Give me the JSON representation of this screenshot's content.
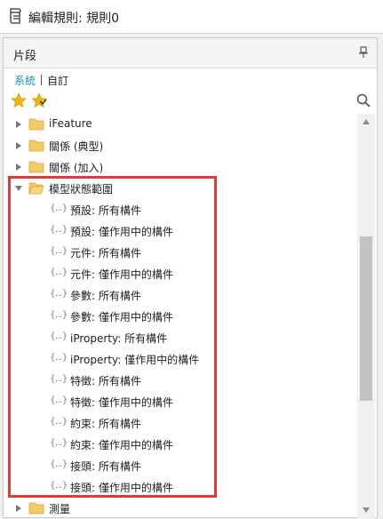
{
  "title": "編輯規則: 規則0",
  "panel": {
    "title": "片段",
    "tabs": {
      "system": "系統",
      "custom": "自訂"
    }
  },
  "tree": {
    "folders_top": [
      {
        "label": "iFeature",
        "expanded": false
      },
      {
        "label": "關係 (典型)",
        "expanded": false
      },
      {
        "label": "關係 (加入)",
        "expanded": false
      }
    ],
    "open_folder": {
      "label": "模型狀態範圍",
      "expanded": true,
      "snippet_icon": "{...}",
      "items": [
        "預設: 所有構件",
        "預設: 僅作用中的構件",
        "元件: 所有構件",
        "元件: 僅作用中的構件",
        "參數: 所有構件",
        "參數: 僅作用中的構件",
        "iProperty: 所有構件",
        "iProperty: 僅作用中的構件",
        "特徵: 所有構件",
        "特徵: 僅作用中的構件",
        "約束: 所有構件",
        "約束: 僅作用中的構件",
        "接頭: 所有構件",
        "接頭: 僅作用中的構件"
      ]
    },
    "folders_bottom": [
      {
        "label": "測量",
        "expanded": false
      }
    ]
  },
  "colors": {
    "accent_link": "#1a8fb8",
    "highlight_border": "#e53935",
    "folder": "#f5c964",
    "star": "#e8a800"
  },
  "icons": {
    "title": "rule-document-icon",
    "pin": "pin-icon",
    "favorite": "star-icon",
    "add_favorite": "star-add-icon",
    "search": "search-icon",
    "folder": "folder-icon",
    "snippet": "snippet-braces-icon"
  }
}
